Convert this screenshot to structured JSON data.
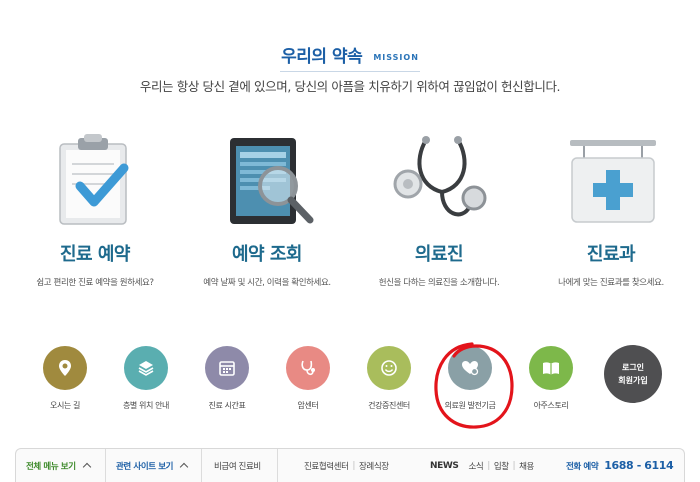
{
  "mission": {
    "title": "우리의 약속",
    "title_en": "MISSION",
    "subtitle": "우리는 항상 당신 곁에 있으며, 당신의 아픔을 치유하기 위하여 끊임없이 헌신합니다."
  },
  "features": [
    {
      "title": "진료 예약",
      "desc": "쉽고 편리한 진료 예약을 원하세요?",
      "icon": "clipboard-check-icon"
    },
    {
      "title": "예약 조회",
      "desc": "예약 날짜 및 시간, 이력을 확인하세요.",
      "icon": "tablet-magnifier-icon"
    },
    {
      "title": "의료진",
      "desc": "헌신을 다하는 의료진을 소개합니다.",
      "icon": "stethoscope-icon"
    },
    {
      "title": "진료과",
      "desc": "나에게 맞는 진료과를 찾으세요.",
      "icon": "hospital-sign-icon"
    }
  ],
  "quick_links": [
    {
      "label": "오시는 길",
      "color": "#a08a3e",
      "icon": "map-pin-icon"
    },
    {
      "label": "층별 위치 안내",
      "color": "#5aaeb0",
      "icon": "layers-icon"
    },
    {
      "label": "진료 시간표",
      "color": "#8e8aa9",
      "icon": "calendar-icon"
    },
    {
      "label": "암센터",
      "color": "#e88a84",
      "icon": "stethoscope-icon"
    },
    {
      "label": "건강증진센터",
      "color": "#a9bd5c",
      "icon": "smile-icon"
    },
    {
      "label": "의료원 발전기금",
      "color": "#8aa0a6",
      "icon": "heart-coin-icon"
    },
    {
      "label": "아주스토리",
      "color": "#7db84a",
      "icon": "book-icon"
    }
  ],
  "login": {
    "line1": "로그인",
    "line2": "회원가입"
  },
  "bottom_bar": {
    "all_menu": "전체 메뉴 보기",
    "related_sites": "관련 사이트 보기",
    "noninsured": "비급여 진료비",
    "links": [
      "진료협력센터",
      "장례식장"
    ],
    "news_label": "NEWS",
    "news_links": [
      "소식",
      "입찰",
      "채용"
    ],
    "phone_label": "전화 예약",
    "phone_number": "1688 - 6114"
  }
}
